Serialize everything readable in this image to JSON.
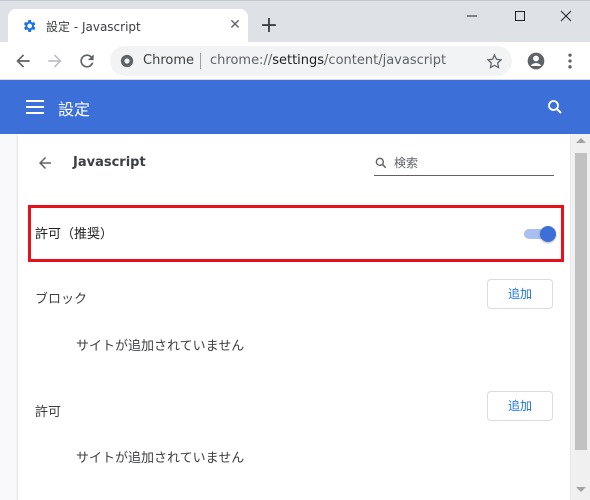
{
  "tab": {
    "title": "設定 - Javascript",
    "icon": "gear-icon"
  },
  "toolbar": {
    "chip": "Chrome",
    "url_scheme": "chrome://",
    "url_host": "settings",
    "url_path": "/content/javascript"
  },
  "header": {
    "title": "設定"
  },
  "page": {
    "title": "Javascript",
    "search_placeholder": "検索"
  },
  "allow_toggle": {
    "label": "許可（推奨）",
    "enabled": true
  },
  "block_section": {
    "label": "ブロック",
    "add_label": "追加",
    "empty_text": "サイトが追加されていません"
  },
  "allow_section": {
    "label": "許可",
    "add_label": "追加",
    "empty_text": "サイトが追加されていません"
  },
  "colors": {
    "header_bg": "#3c6fd8",
    "highlight_border": "#e8101a",
    "accent": "#1a73e8"
  }
}
